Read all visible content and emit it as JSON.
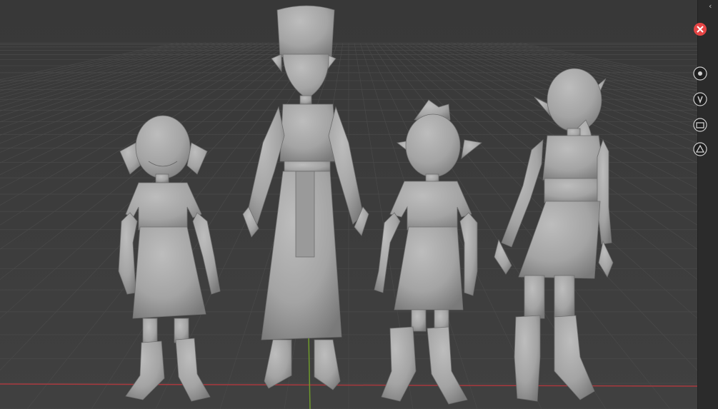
{
  "app": {
    "window": "3D Viewport"
  },
  "viewport": {
    "background_color": "#3d3d3d",
    "grid_color": "#4a4a4a",
    "x_axis_color": "#a8393e",
    "y_axis_color": "#6f9a2c",
    "shading": "solid",
    "models": [
      {
        "name": "short-hair-child-figure",
        "kind": "sculpt"
      },
      {
        "name": "tall-robed-figure",
        "kind": "sculpt"
      },
      {
        "name": "spiky-hair-child-figure",
        "kind": "sculpt"
      },
      {
        "name": "ponytail-girl-figure",
        "kind": "sculpt"
      }
    ]
  },
  "right_strip": {
    "collapse_icon": "chevron-left-icon",
    "buttons": [
      {
        "icon": "close-circle-icon",
        "color": "#e54545"
      },
      {
        "icon": "rotate-gizmo-icon"
      },
      {
        "icon": "pan-hand-icon"
      },
      {
        "icon": "camera-icon"
      },
      {
        "icon": "ortho-toggle-icon"
      }
    ]
  }
}
